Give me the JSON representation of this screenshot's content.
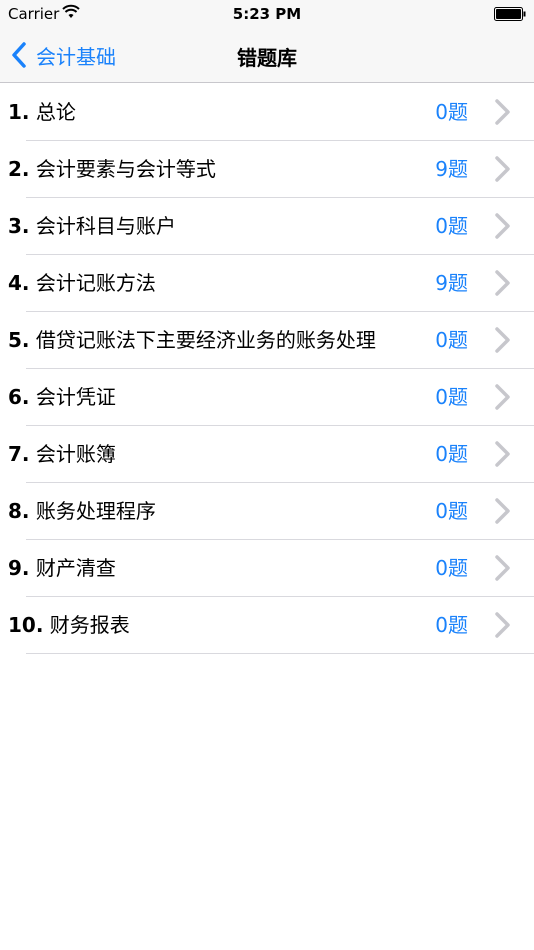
{
  "status_bar": {
    "carrier": "Carrier",
    "time": "5:23 PM"
  },
  "nav": {
    "back_label": "会计基础",
    "title": "错题库"
  },
  "colors": {
    "accent": "#1a82fb",
    "chevron": "#c7c7cc"
  },
  "items": [
    {
      "num": "1.",
      "title": "总论",
      "count": "0题"
    },
    {
      "num": "2.",
      "title": "会计要素与会计等式",
      "count": "9题"
    },
    {
      "num": "3.",
      "title": "会计科目与账户",
      "count": "0题"
    },
    {
      "num": "4.",
      "title": "会计记账方法",
      "count": "9题"
    },
    {
      "num": "5.",
      "title": "借贷记账法下主要经济业务的账务处理",
      "count": "0题"
    },
    {
      "num": "6.",
      "title": "会计凭证",
      "count": "0题"
    },
    {
      "num": "7.",
      "title": "会计账簿",
      "count": "0题"
    },
    {
      "num": "8.",
      "title": "账务处理程序",
      "count": "0题"
    },
    {
      "num": "9.",
      "title": "财产清查",
      "count": "0题"
    },
    {
      "num": "10.",
      "title": "财务报表",
      "count": "0题"
    }
  ]
}
